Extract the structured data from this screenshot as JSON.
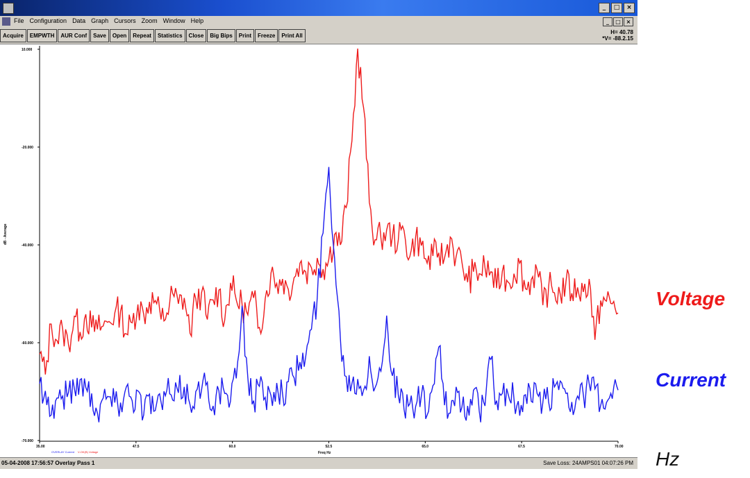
{
  "window": {
    "title": "",
    "controls": [
      "_",
      "□",
      "×"
    ],
    "child_controls": [
      "_",
      "□",
      "×"
    ]
  },
  "menubar": {
    "items": [
      "File",
      "Configuration",
      "Data",
      "Graph",
      "Cursors",
      "Zoom",
      "Window",
      "Help"
    ]
  },
  "toolbar": {
    "buttons": [
      "Acquire",
      "EMPWTH",
      "AUR Conf",
      "Save",
      "Open",
      "Repeat",
      "Statistics",
      "Close",
      "Big Bips",
      "Print",
      "Freeze",
      "Print All"
    ]
  },
  "readout": {
    "h": "H= 40.78",
    "v": "*V= -88.2.15"
  },
  "status": {
    "left": "05-04-2008 17:56:57 Overlay Pass 1",
    "right": "Save Loss: 24AMPS01 04:07:26 PM"
  },
  "labels": {
    "voltage": "Voltage",
    "current": "Current",
    "hz": "Hz"
  },
  "colors": {
    "voltage": "#ee1b1b",
    "current": "#1b1bee"
  },
  "chart_data": {
    "type": "line",
    "xlabel": "Freq Hz",
    "ylabel": "dB - Average",
    "x_ticks": [
      "35.00",
      "47.5",
      "60.0",
      "52.5",
      "65.0",
      "67.5",
      "70.00"
    ],
    "y_ticks": [
      "10.000",
      "-20.000",
      "-40.000",
      "-60.000",
      "-70.000"
    ],
    "legend": [
      "OVERLAY Current",
      "V-OK(B) Voltage"
    ],
    "series": [
      {
        "name": "Voltage",
        "color": "#ee1b1b",
        "values": [
          -56.7,
          -59.8,
          -52.1,
          -54.6,
          -52.9,
          -55.3,
          -50.9,
          -53.3,
          -50.6,
          -52.6,
          -52.9,
          -52.4,
          -51.7,
          -50.4,
          -50.1,
          -53.6,
          -51.9,
          -49.1,
          -50.6,
          -48.7,
          -48.5,
          -51.4,
          -50.4,
          -47.4,
          -49.0,
          -48.1,
          -53.5,
          -48.2,
          -47.3,
          -51.4,
          -48.4,
          -46.9,
          -51.5,
          -45.8,
          -48.4,
          -49.1,
          -50.7,
          -48.1,
          -52.6,
          -48.2,
          -44.3,
          -45.9,
          -45.2,
          -46.8,
          -45.0,
          -42.8,
          -44.1,
          -43.5,
          -42.0,
          -43.7,
          -42.2,
          -38.4,
          -40.0,
          -34.3,
          -24.1,
          -10.0,
          -19.0,
          -33.5,
          -39.2,
          -38.9,
          -37.7,
          -38.7,
          -39.3,
          -37.8,
          -41.8,
          -38.8,
          -40.1,
          -42.8,
          -41.7,
          -41.2,
          -42.0,
          -38.8,
          -41.8,
          -42.6,
          -45.7,
          -44.1,
          -44.4,
          -43.5,
          -44.1,
          -46.6,
          -44.0,
          -45.7,
          -44.4,
          -42.8,
          -46.7,
          -45.3,
          -43.8,
          -49.2,
          -46.4,
          -47.3,
          -47.5,
          -45.6,
          -47.4,
          -46.5,
          -47.2,
          -45.2,
          -54.5,
          -48.5,
          -48.6,
          -49.0,
          -50.4
        ]
      },
      {
        "name": "Current",
        "color": "#1b1bee",
        "values": [
          -61.2,
          -62.3,
          -66.0,
          -63.4,
          -63.1,
          -62.5,
          -61.9,
          -60.6,
          -61.8,
          -62.7,
          -65.7,
          -63.4,
          -63.2,
          -64.1,
          -64.1,
          -61.7,
          -63.8,
          -62.3,
          -66.0,
          -62.8,
          -65.3,
          -64.0,
          -62.2,
          -63.7,
          -62.6,
          -61.7,
          -64.4,
          -62.4,
          -62.2,
          -61.0,
          -64.6,
          -62.3,
          -62.7,
          -63.9,
          -60.4,
          -49.3,
          -60.3,
          -63.8,
          -61.6,
          -63.3,
          -63.0,
          -61.1,
          -62.8,
          -60.9,
          -60.3,
          -57.9,
          -57.1,
          -52.9,
          -48.1,
          -38.2,
          -28.1,
          -42.0,
          -54.4,
          -60.1,
          -61.2,
          -60.5,
          -62.2,
          -57.0,
          -61.8,
          -59.3,
          -50.8,
          -60.0,
          -62.9,
          -65.1,
          -64.3,
          -64.7,
          -63.0,
          -66.0,
          -61.5,
          -55.6,
          -64.5,
          -65.7,
          -61.7,
          -64.8,
          -64.6,
          -62.2,
          -65.4,
          -64.6,
          -57.5,
          -63.8,
          -62.7,
          -62.8,
          -63.5,
          -66.1,
          -62.9,
          -63.9,
          -62.7,
          -64.1,
          -64.0,
          -61.7,
          -60.8,
          -62.7,
          -64.0,
          -63.1,
          -62.9,
          -61.2,
          -62.0,
          -64.5,
          -64.1,
          -63.5,
          -62.2
        ]
      }
    ],
    "ylim": [
      -70,
      -10
    ],
    "grid": false,
    "legend_placement": "bottom-left"
  }
}
